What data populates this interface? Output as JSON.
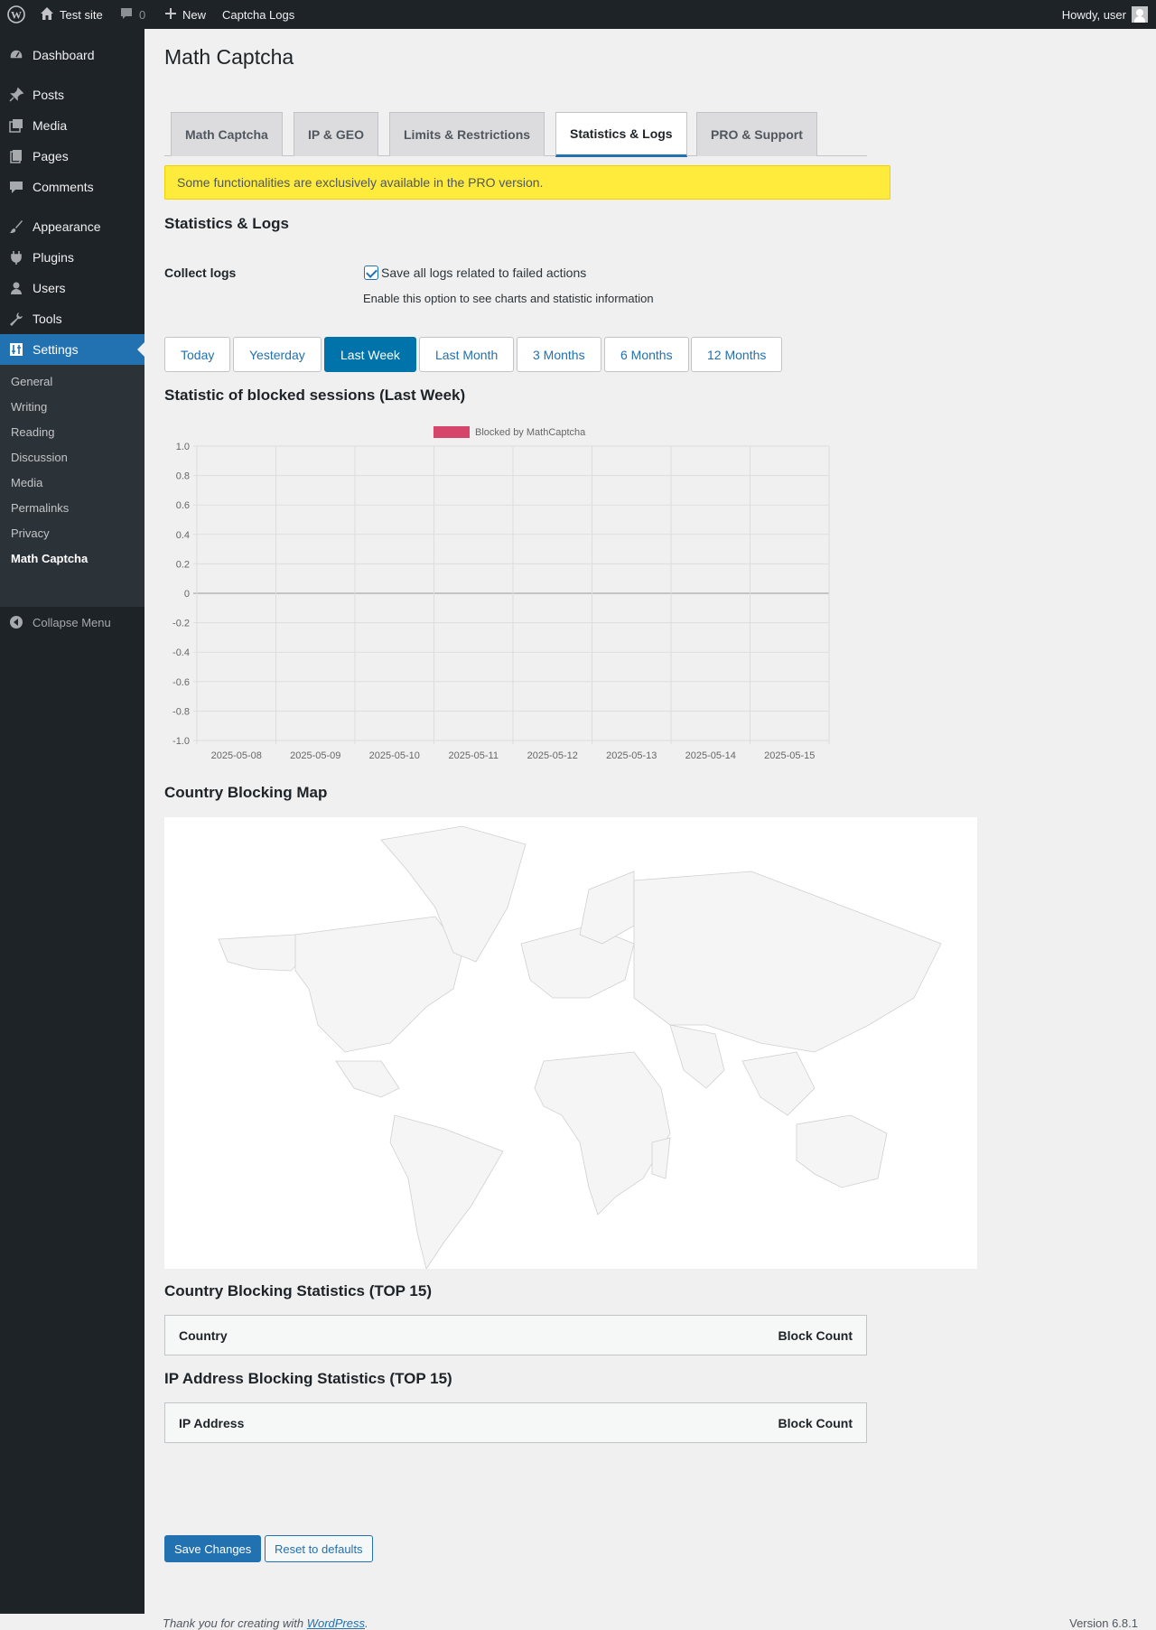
{
  "adminbar": {
    "site_name": "Test site",
    "comments_count": "0",
    "new_label": "New",
    "captcha_logs": "Captcha Logs",
    "howdy": "Howdy, user"
  },
  "sidebar": {
    "items": [
      {
        "label": "Dashboard",
        "icon": "dashboard-icon"
      },
      {
        "label": "Posts",
        "icon": "pin-icon"
      },
      {
        "label": "Media",
        "icon": "media-icon"
      },
      {
        "label": "Pages",
        "icon": "pages-icon"
      },
      {
        "label": "Comments",
        "icon": "comments-icon"
      },
      {
        "label": "Appearance",
        "icon": "brush-icon"
      },
      {
        "label": "Plugins",
        "icon": "plugin-icon"
      },
      {
        "label": "Users",
        "icon": "users-icon"
      },
      {
        "label": "Tools",
        "icon": "wrench-icon"
      },
      {
        "label": "Settings",
        "icon": "settings-icon"
      }
    ],
    "submenu": [
      "General",
      "Writing",
      "Reading",
      "Discussion",
      "Media",
      "Permalinks",
      "Privacy",
      "Math Captcha"
    ],
    "collapse": "Collapse Menu"
  },
  "page": {
    "title": "Math Captcha",
    "tabs": [
      "Math Captcha",
      "IP & GEO",
      "Limits & Restrictions",
      "Statistics & Logs",
      "PRO & Support"
    ],
    "active_tab": "Statistics & Logs",
    "notice": "Some functionalities are exclusively available in the PRO version.",
    "section_title": "Statistics & Logs",
    "collect_logs": {
      "label": "Collect logs",
      "checkbox_label": "Save all logs related to failed actions",
      "checked": true,
      "description": "Enable this option to see charts and statistic information"
    },
    "ranges": [
      "Today",
      "Yesterday",
      "Last Week",
      "Last Month",
      "3 Months",
      "6 Months",
      "12 Months"
    ],
    "active_range": "Last Week",
    "chart_title": "Statistic of blocked sessions (Last Week)",
    "map_title": "Country Blocking Map",
    "country_stats_title": "Country Blocking Statistics (TOP 15)",
    "country_table": {
      "col1": "Country",
      "col2": "Block Count"
    },
    "ip_stats_title": "IP Address Blocking Statistics (TOP 15)",
    "ip_table": {
      "col1": "IP Address",
      "col2": "Block Count"
    },
    "save_button": "Save Changes",
    "reset_button": "Reset to defaults"
  },
  "footer": {
    "thanks_prefix": "Thank you for creating with ",
    "wordpress_link": "WordPress",
    "thanks_suffix": ".",
    "version": "Version 6.8.1"
  },
  "colors": {
    "admin_dark": "#1d2327",
    "accent": "#2271b1",
    "notice_bg": "#ffeb3b",
    "series": "#d6466a"
  },
  "chart_data": {
    "type": "bar",
    "categories": [
      "2025-05-08",
      "2025-05-09",
      "2025-05-10",
      "2025-05-11",
      "2025-05-12",
      "2025-05-13",
      "2025-05-14",
      "2025-05-15"
    ],
    "series": [
      {
        "name": "Blocked by MathCaptcha",
        "values": [
          0,
          0,
          0,
          0,
          0,
          0,
          0,
          0
        ],
        "color": "#d6466a"
      }
    ],
    "ylim": [
      -1.0,
      1.0
    ],
    "yticks": [
      "1.0",
      "0.8",
      "0.6",
      "0.4",
      "0.2",
      "0",
      "-0.2",
      "-0.4",
      "-0.6",
      "-0.8",
      "-1.0"
    ],
    "legend_position": "top-center",
    "grid": true
  }
}
